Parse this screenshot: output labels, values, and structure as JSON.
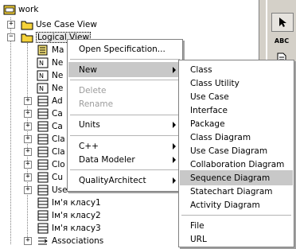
{
  "tree": {
    "root": "work",
    "use_case_view": "Use Case View",
    "logical_view": "Logical View",
    "children": [
      "Ma",
      "Ne",
      "Ne",
      "Ne",
      "Ad",
      "Ca",
      "Ca",
      "Cla",
      "Cla",
      "Clo",
      "Cu",
      "Cu",
      "User",
      "Ім'я класу1",
      "Ім'я класу2",
      "Ім'я класу3",
      "Associations"
    ]
  },
  "toolbar": {
    "abc_label": "ABC"
  },
  "context_menu": {
    "open_specification": "Open Specification...",
    "new": "New",
    "delete": "Delete",
    "rename": "Rename",
    "units": "Units",
    "cpp": "C++",
    "data_modeler": "Data Modeler",
    "quality_architect": "QualityArchitect"
  },
  "new_submenu": {
    "items": [
      "Class",
      "Class Utility",
      "Use Case",
      "Interface",
      "Package",
      "Class Diagram",
      "Use Case Diagram",
      "Collaboration Diagram",
      "Sequence Diagram",
      "Statechart Diagram",
      "Activity Diagram"
    ],
    "file": "File",
    "url": "URL",
    "highlighted": "Sequence Diagram"
  },
  "colors": {
    "folder": "#f5d23a",
    "highlight": "#c8c8c8",
    "panel": "#d4d0c8"
  }
}
